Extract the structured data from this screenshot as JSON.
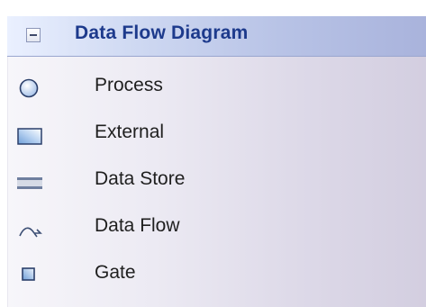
{
  "header": {
    "title": "Data Flow Diagram",
    "collapse_icon": "minus-box-icon"
  },
  "items": [
    {
      "label": "Process",
      "icon": "process-circle-icon"
    },
    {
      "label": "External",
      "icon": "external-entity-icon"
    },
    {
      "label": "Data Store",
      "icon": "data-store-icon"
    },
    {
      "label": "Data Flow",
      "icon": "data-flow-arrow-icon"
    },
    {
      "label": "Gate",
      "icon": "gate-square-icon"
    }
  ],
  "colors": {
    "header_text": "#1d3a8c",
    "item_text": "#1f1f1f",
    "header_bg": "#b8c3e6"
  }
}
